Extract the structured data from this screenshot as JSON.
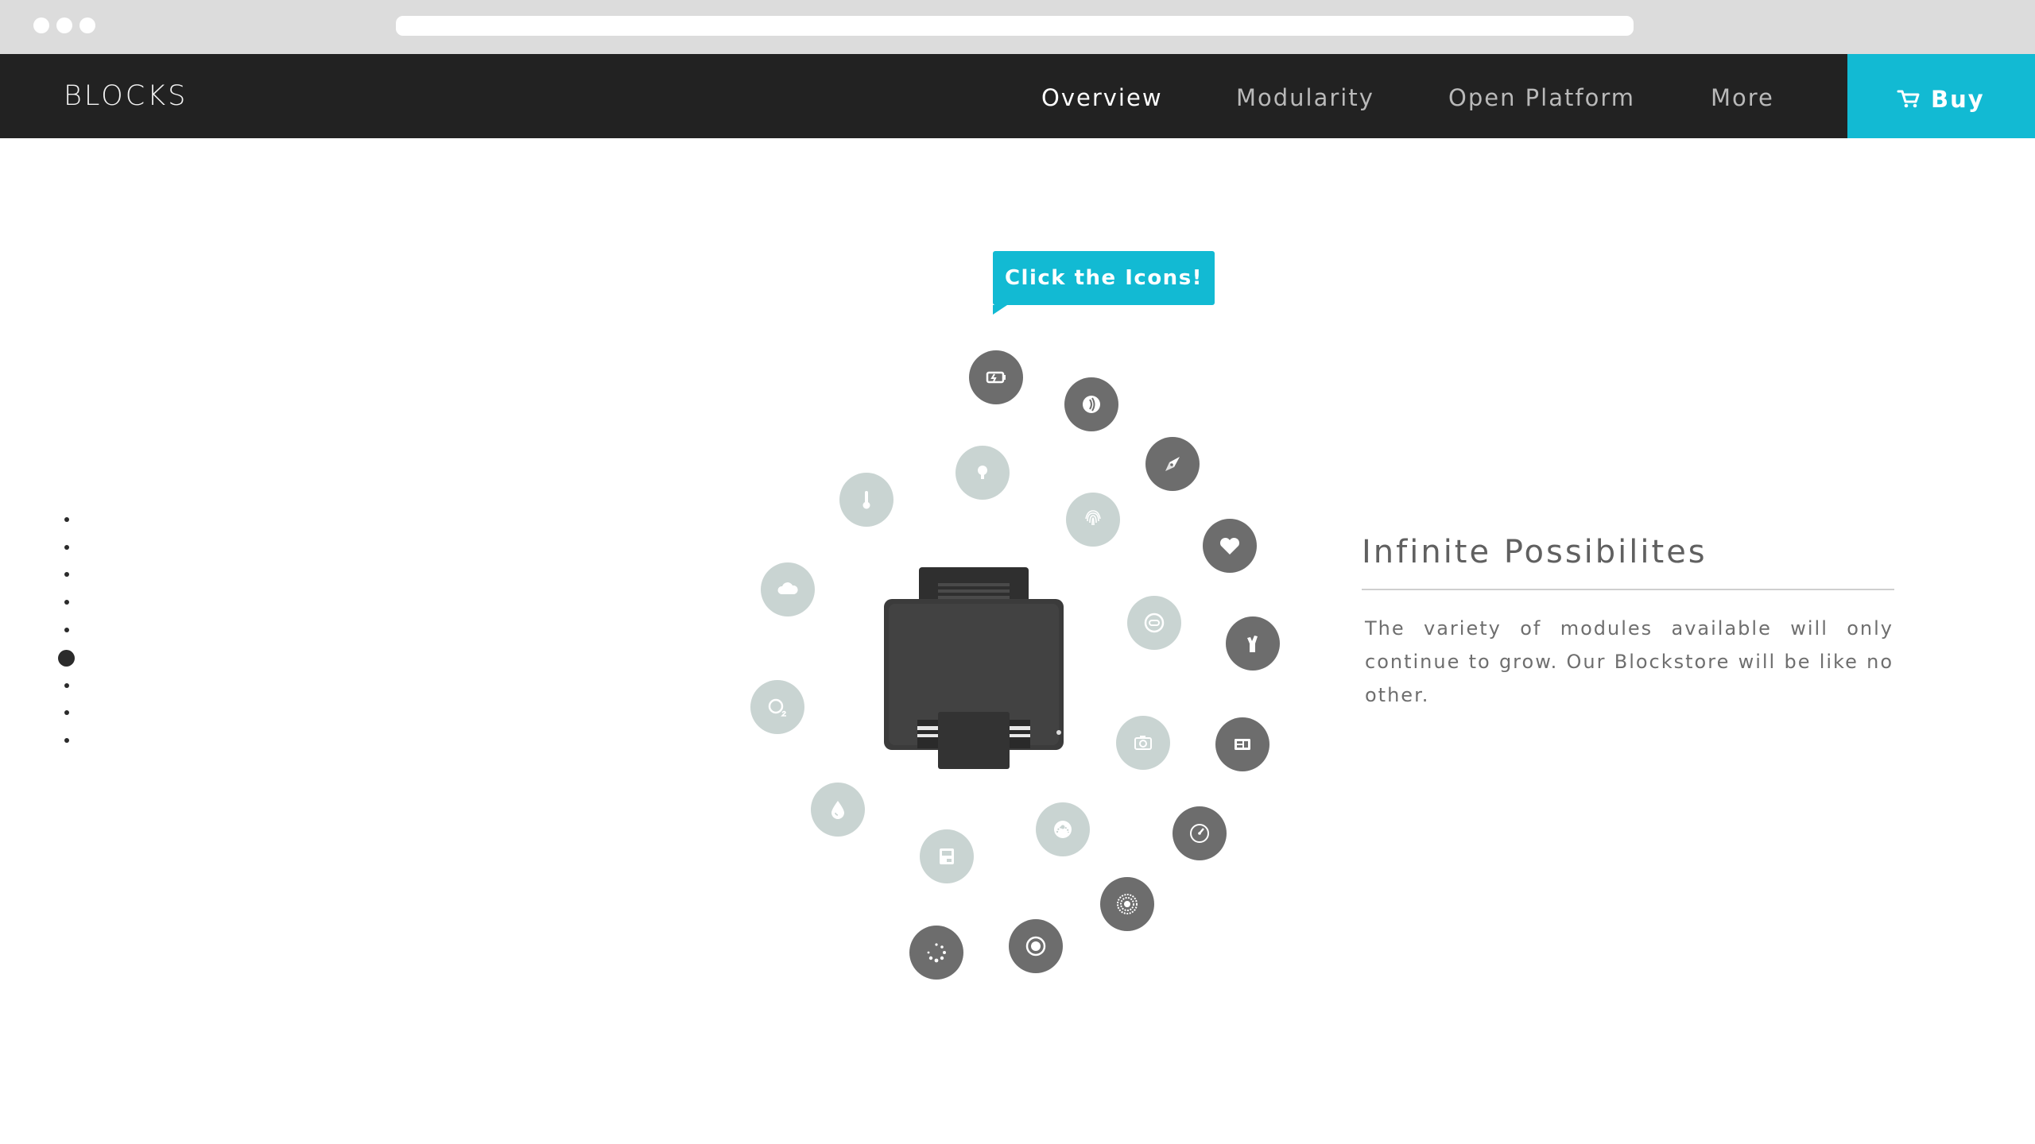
{
  "brand": "BLOCKS",
  "nav": {
    "items": [
      {
        "label": "Overview",
        "active": true
      },
      {
        "label": "Modularity",
        "active": false
      },
      {
        "label": "Open Platform",
        "active": false
      },
      {
        "label": "More",
        "active": false
      }
    ],
    "buy_label": "Buy"
  },
  "colors": {
    "accent": "#12bad3",
    "nav_bg": "#222222",
    "icon_dark": "#6d6d6d",
    "icon_light": "#c9d4d2"
  },
  "pager": {
    "count": 9,
    "active_index": 5
  },
  "tooltip": "Click the Icons!",
  "modules": [
    {
      "icon": "battery-icon",
      "tone": "dark"
    },
    {
      "icon": "nfc-icon",
      "tone": "dark"
    },
    {
      "icon": "compass-icon",
      "tone": "dark"
    },
    {
      "icon": "heart-icon",
      "tone": "dark"
    },
    {
      "icon": "gesture-icon",
      "tone": "dark"
    },
    {
      "icon": "sim-card-icon",
      "tone": "dark"
    },
    {
      "icon": "speedometer-icon",
      "tone": "dark"
    },
    {
      "icon": "speaker-icon",
      "tone": "dark"
    },
    {
      "icon": "record-icon",
      "tone": "dark"
    },
    {
      "icon": "loading-icon",
      "tone": "dark"
    },
    {
      "icon": "thermometer-icon",
      "tone": "light"
    },
    {
      "icon": "lightbulb-icon",
      "tone": "light"
    },
    {
      "icon": "fingerprint-icon",
      "tone": "light"
    },
    {
      "icon": "cloud-icon",
      "tone": "light"
    },
    {
      "icon": "link-icon",
      "tone": "light"
    },
    {
      "icon": "oxygen-icon",
      "tone": "light"
    },
    {
      "icon": "camera-icon",
      "tone": "light"
    },
    {
      "icon": "water-drop-icon",
      "tone": "light"
    },
    {
      "icon": "storage-icon",
      "tone": "light"
    },
    {
      "icon": "gauge-icon",
      "tone": "light"
    }
  ],
  "feature": {
    "title": "Infinite Possibilites",
    "body": "The variety of modules available will only continue to grow. Our Blockstore will be like no other."
  }
}
